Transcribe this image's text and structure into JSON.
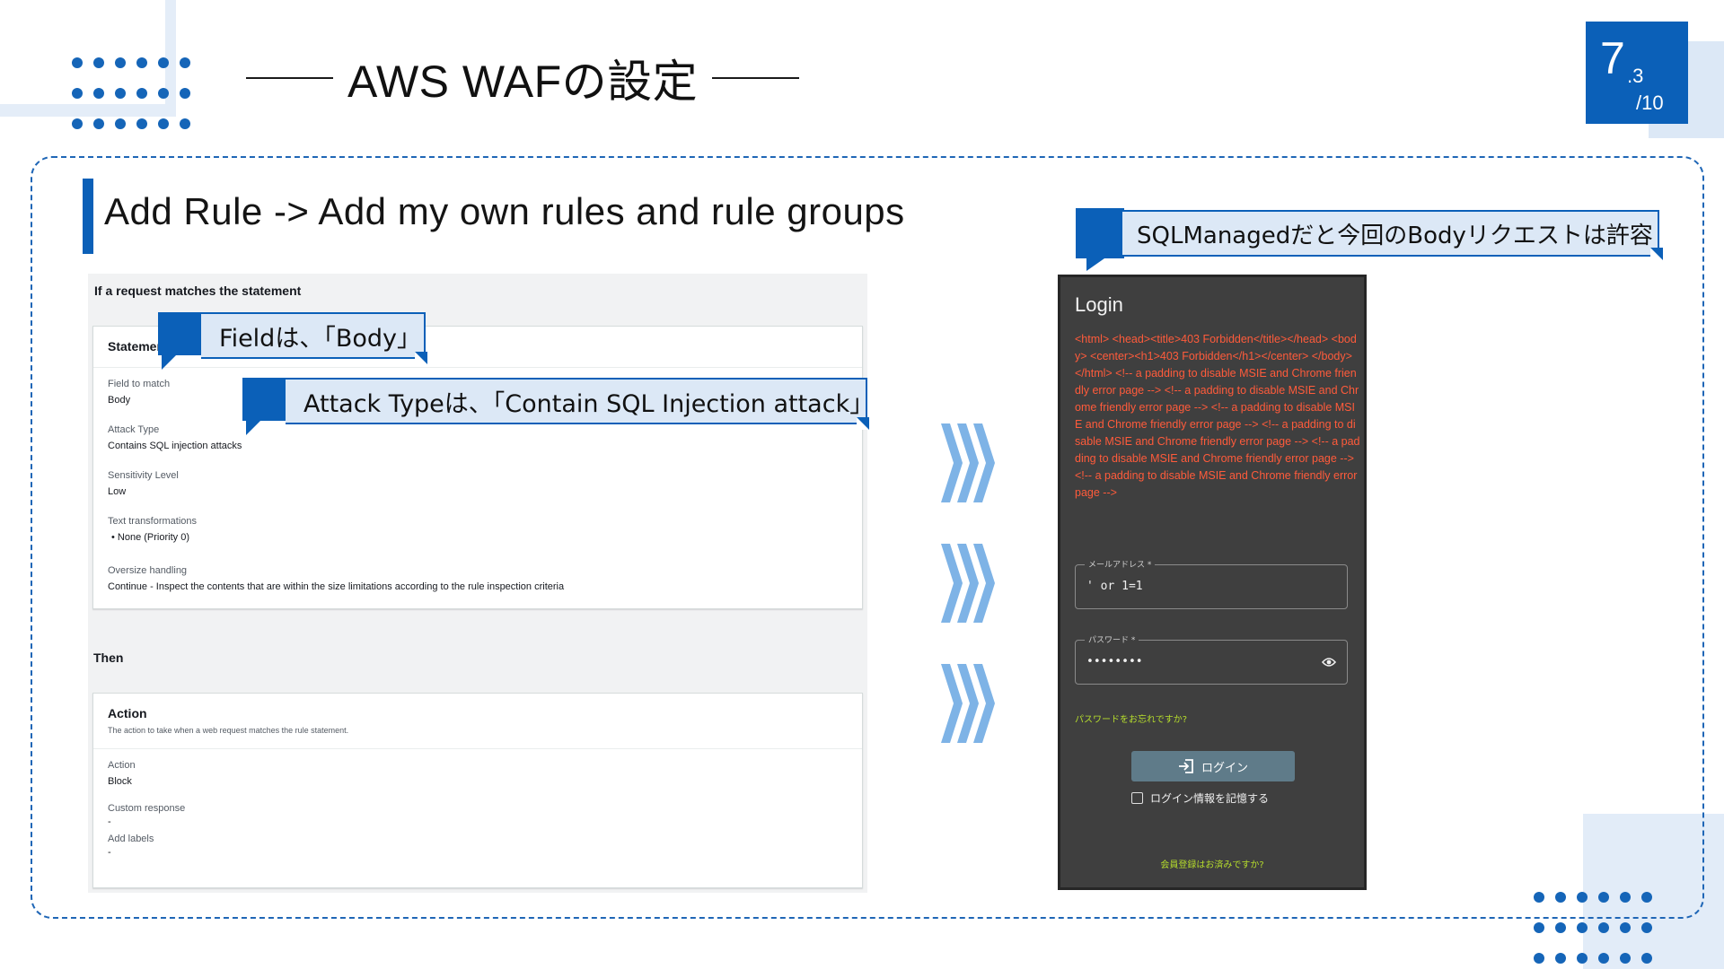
{
  "header": {
    "title": "AWS WAFの設定",
    "page_current": "7",
    "page_sub": ".3",
    "page_total": "/10"
  },
  "section": {
    "title": "Add Rule -> Add my own rules and rule groups"
  },
  "aws_console": {
    "statement_heading": "If a request matches the statement",
    "statement_card_title": "Statement",
    "fields": [
      {
        "label": "Field to match",
        "value": "Body"
      },
      {
        "label": "Attack Type",
        "value": "Contains SQL injection attacks"
      },
      {
        "label": "Sensitivity Level",
        "value": "Low"
      },
      {
        "label": "Text transformations",
        "value": "•  None (Priority 0)"
      },
      {
        "label": "Oversize handling",
        "value": "Continue - Inspect the contents that are within the size limitations according to the rule inspection criteria"
      }
    ],
    "then_heading": "Then",
    "action_card": {
      "title": "Action",
      "description": "The action to take when a web request matches the rule statement.",
      "fields": [
        {
          "label": "Action",
          "value": "Block"
        },
        {
          "label": "Custom response",
          "value": "-"
        },
        {
          "label": "Add labels",
          "value": "-"
        }
      ]
    }
  },
  "callouts": {
    "field": "Fieldは、「Body」",
    "attack_type": "Attack Typeは、「Contain SQL Injection attack」",
    "sql_managed": "SQLManagedだと今回のBodyリクエストは許容"
  },
  "login": {
    "title": "Login",
    "error_html": "<html> <head><title>403 Forbidden</title></head> <body> <center><h1>403 Forbidden</h1></center> </body> </html> <!-- a padding to disable MSIE and Chrome friendly error page --> <!-- a padding to disable MSIE and Chrome friendly error page --> <!-- a padding to disable MSIE and Chrome friendly error page --> <!-- a padding to disable MSIE and Chrome friendly error page --> <!-- a padding to disable MSIE and Chrome friendly error page --> <!-- a padding to disable MSIE and Chrome friendly error page -->",
    "email_label": "メールアドレス *",
    "email_value": "' or 1=1",
    "password_label": "パスワード *",
    "password_value": "••••••••",
    "forgot_link": "パスワードをお忘れですか?",
    "login_button": "ログイン",
    "remember_label": "ログイン情報を記憶する",
    "register_link": "会員登録はお済みですか?"
  },
  "colors": {
    "brand_blue": "#0b60b8",
    "callout_fill": "#dce8f6",
    "arrow_blue": "#7eb3e6",
    "error_red": "#ff5b3b",
    "link_green": "#b6dd2c"
  },
  "icons": {
    "chevrons": "triple-chevron-right-icon",
    "eye": "eye-icon",
    "login": "login-arrow-icon"
  }
}
